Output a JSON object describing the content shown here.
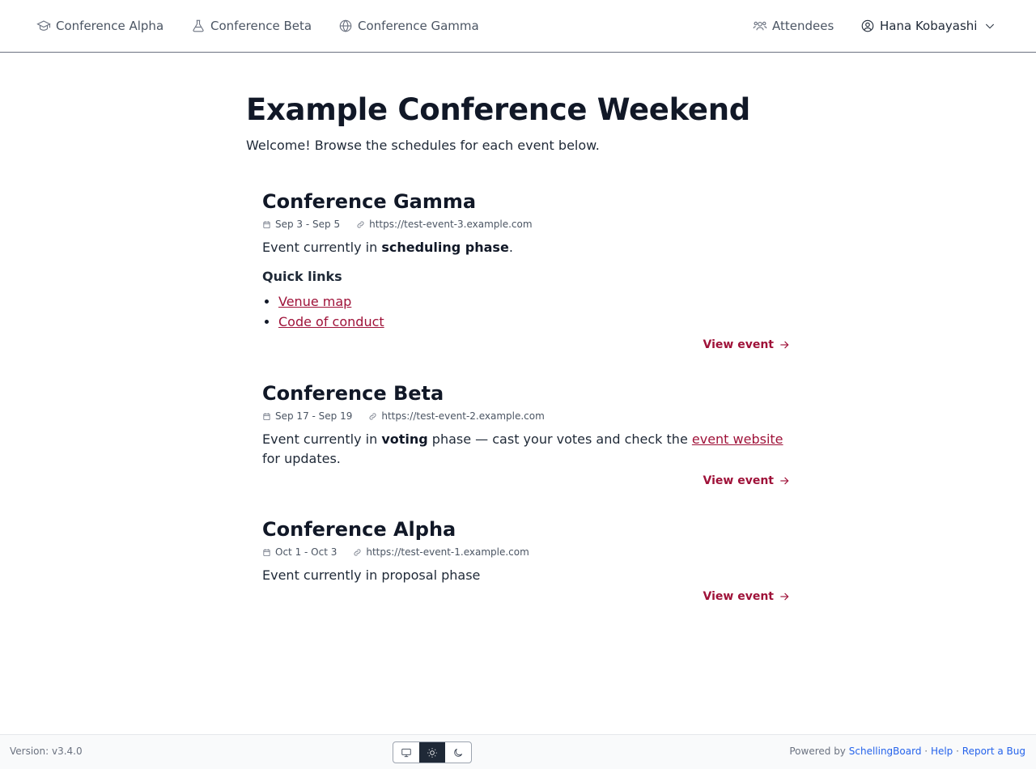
{
  "nav": {
    "items": [
      {
        "label": "Conference Alpha",
        "icon": "graduation-cap-icon"
      },
      {
        "label": "Conference Beta",
        "icon": "flask-icon"
      },
      {
        "label": "Conference Gamma",
        "icon": "globe-icon"
      }
    ],
    "attendees_label": "Attendees",
    "user_name": "Hana Kobayashi"
  },
  "page": {
    "title": "Example Conference Weekend",
    "subtitle": "Welcome! Browse the schedules for each event below."
  },
  "events": [
    {
      "title": "Conference Gamma",
      "dates": "Sep 3 - Sep 5",
      "url": "https://test-event-3.example.com",
      "desc_prefix": "Event currently in ",
      "desc_bold": "scheduling phase",
      "desc_suffix": ".",
      "quick_links_title": "Quick links",
      "quick_links": [
        "Venue map",
        "Code of conduct"
      ],
      "view_label": "View event"
    },
    {
      "title": "Conference Beta",
      "dates": "Sep 17 - Sep 19",
      "url": "https://test-event-2.example.com",
      "desc_prefix": "Event currently in ",
      "desc_bold": "voting",
      "desc_middle": " phase — cast your votes and check the ",
      "desc_link": "event website",
      "desc_suffix": " for updates.",
      "view_label": "View event"
    },
    {
      "title": "Conference Alpha",
      "dates": "Oct 1 - Oct 3",
      "url": "https://test-event-1.example.com",
      "desc": "Event currently in proposal phase",
      "view_label": "View event"
    }
  ],
  "footer": {
    "version": "Version: v3.4.0",
    "theme_options": [
      "system",
      "light",
      "dark"
    ],
    "theme_selected": "light",
    "powered_by": "Powered by",
    "brand_link": "SchellingBoard",
    "separator": "·",
    "help_link": "Help",
    "report_link": "Report a Bug"
  },
  "colors": {
    "accent": "#9f1239",
    "link_blue": "#2563eb",
    "text_dark": "#111827"
  }
}
